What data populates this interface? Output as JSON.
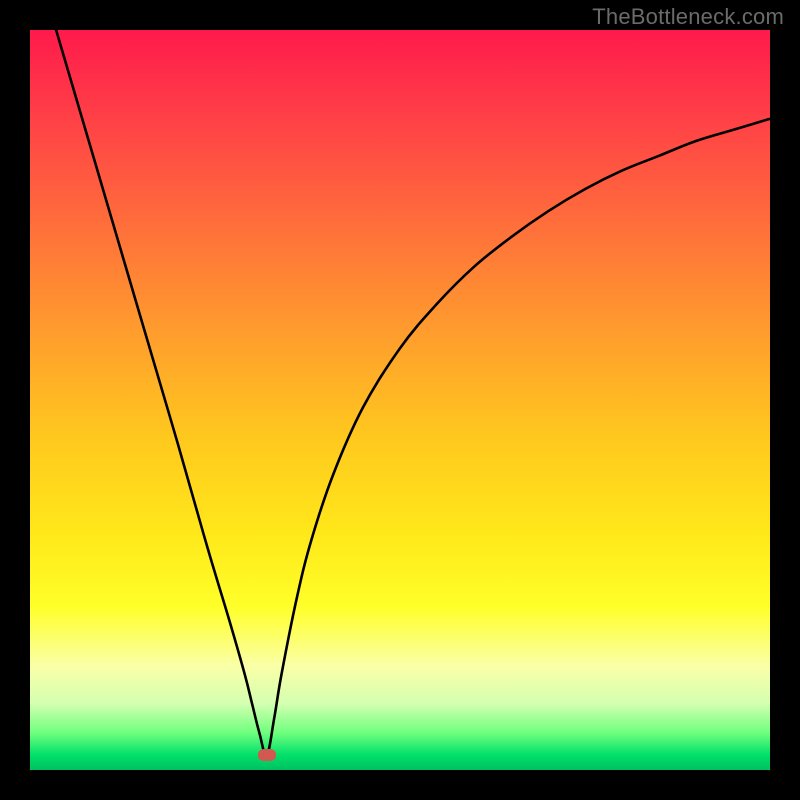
{
  "watermark": "TheBottleneck.com",
  "colors": {
    "frame": "#000000",
    "curve": "#000000",
    "marker": "#d1594f",
    "gradient_top": "#ff1a4b",
    "gradient_bottom": "#00c060"
  },
  "chart_data": {
    "type": "line",
    "title": "",
    "xlabel": "",
    "ylabel": "",
    "xlim": [
      0,
      100
    ],
    "ylim": [
      0,
      100
    ],
    "grid": false,
    "legend": false,
    "minimum_x": 32,
    "minimum_y": 2,
    "series": [
      {
        "name": "bottleneck-curve",
        "x": [
          0,
          5,
          10,
          15,
          20,
          24,
          27,
          29,
          30,
          31,
          32,
          33,
          34,
          36,
          38,
          41,
          45,
          50,
          55,
          60,
          65,
          70,
          75,
          80,
          85,
          90,
          95,
          100
        ],
        "y": [
          112,
          95,
          78,
          61,
          44,
          30,
          20,
          13,
          9,
          5,
          2,
          7,
          13,
          23,
          31,
          40,
          49,
          57,
          63,
          68,
          72,
          75.5,
          78.5,
          81,
          83,
          85,
          86.5,
          88
        ]
      }
    ],
    "annotations": [
      {
        "type": "marker",
        "x": 32,
        "y": 2,
        "shape": "ellipse",
        "color": "#d1594f"
      }
    ]
  }
}
